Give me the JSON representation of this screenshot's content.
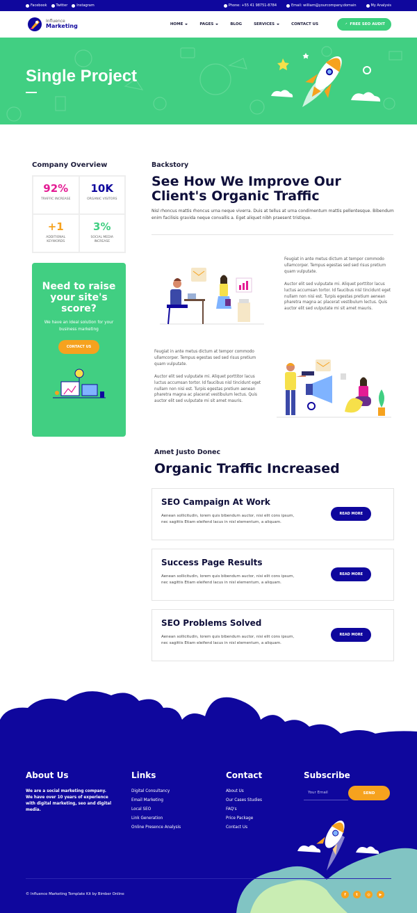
{
  "topbar": {
    "left": [
      "Facebook",
      "Twitter",
      "Instagram"
    ],
    "phone": "Phone: +55 41 98751-8784",
    "email": "Email: william@yourcompany.domain",
    "account": "My Analysis"
  },
  "header": {
    "logo_line1": "Influence",
    "logo_line2": "Marketing",
    "nav": [
      "HOME",
      "PAGES",
      "BLOG",
      "SERVICES",
      "CONTACT US"
    ],
    "cta": "FREE SEO AUDIT"
  },
  "hero": {
    "title": "Single Project"
  },
  "sidebar": {
    "overview_title": "Company Overview",
    "stats": [
      {
        "value": "92%",
        "label": "TRAFFIC INCREASE",
        "color": "#e41c94"
      },
      {
        "value": "10K",
        "label": "ORGANIC VISITORS",
        "color": "#0f079d"
      },
      {
        "value": "+1",
        "label": "ADDITIONAL KEYWORDS",
        "color": "#f6a21e"
      },
      {
        "value": "3%",
        "label": "SOCIAL MEDIA INCREASE",
        "color": "#41cf82"
      }
    ],
    "card_title": "Need to raise your site's score?",
    "card_text": "We have an ideal solution for your business marketing",
    "card_button": "CONTACT US"
  },
  "main": {
    "kicker": "Backstory",
    "title": "See How We Improve Our Client's Organic Traffic",
    "intro": "Nisl rhoncus mattis rhoncus urna neque viverra. Duis at tellus at urna condimentum mattis pellentesque. Bibendum enim facilisis gravida neque convallis a. Eget aliquet nibh praesent tristique.",
    "block1_p1": "Feugiat in ante metus dictum at tempor commodo ullamcorper. Tempus egestas sed sed risus pretium quam vulputate.",
    "block1_p2": "Auctor elit sed vulputate mi. Aliquet porttitor lacus luctus accumsan tortor. Id faucibus nisl tincidunt eget nullam non nisi est. Turpis egestas pretium aenean pharetra magna ac placerat vestibulum lectus. Quis auctor elit sed vulputate mi sit amet mauris.",
    "block2_p1": "Feugiat in ante metus dictum at tempor commodo ullamcorper. Tempus egestas sed sed risus pretium quam vulputate.",
    "block2_p2": "Auctor elit sed vulputate mi. Aliquet porttitor lacus luctus accumsan tortor. Id faucibus nisl tincidunt eget nullam non nisi est. Turpis egestas pretium aenean pharetra magna ac placerat vestibulum lectus. Quis auctor elit sed vulputate mi sit amet mauris.",
    "kicker2": "Amet Justo Donec",
    "title2": "Organic Traffic Increased",
    "features": [
      {
        "title": "SEO Campaign At Work",
        "text": "Aenean sollicitudin, lorem quis bibendum auctor, nisi elit cons ipsum, nec sagittis Etiam eleifend lacus in nisl elementum, a aliquam.",
        "button": "READ MORE"
      },
      {
        "title": "Success Page Results",
        "text": "Aenean sollicitudin, lorem quis bibendum auctor, nisi elit cons ipsum, nec sagittis Etiam eleifend lacus in nisl elementum, a aliquam.",
        "button": "READ MORE"
      },
      {
        "title": "SEO Problems Solved",
        "text": "Aenean sollicitudin, lorem quis bibendum auctor, nisi elit cons ipsum, nec sagittis Etiam eleifend lacus in nisl elementum, a aliquam.",
        "button": "READ MORE"
      }
    ]
  },
  "footer": {
    "about_title": "About Us",
    "about_text": "We are a social marketing company. We have over 10 years of experience with digital marketing, seo and digital media.",
    "links_title": "Links",
    "links": [
      "Digital Consultancy",
      "Email Marketing",
      "Local SEO",
      "Link Generation",
      "Online Presence Analysis"
    ],
    "contact_title": "Contact",
    "contact_links": [
      "About Us",
      "Our Cases Studies",
      "FAQ's",
      "Price Package",
      "Contact Us"
    ],
    "subscribe_title": "Subscribe",
    "email_placeholder": "Your Email",
    "send": "SEND",
    "copyright": "© Influence Marketing Template Kit by Bimber Online",
    "socials": [
      "facebook-icon",
      "twitter-icon",
      "instagram-icon",
      "youtube-icon"
    ]
  },
  "colors": {
    "brand": "#0f079d",
    "green": "#41cf82",
    "orange": "#f6a21e",
    "pink": "#e41c94"
  }
}
